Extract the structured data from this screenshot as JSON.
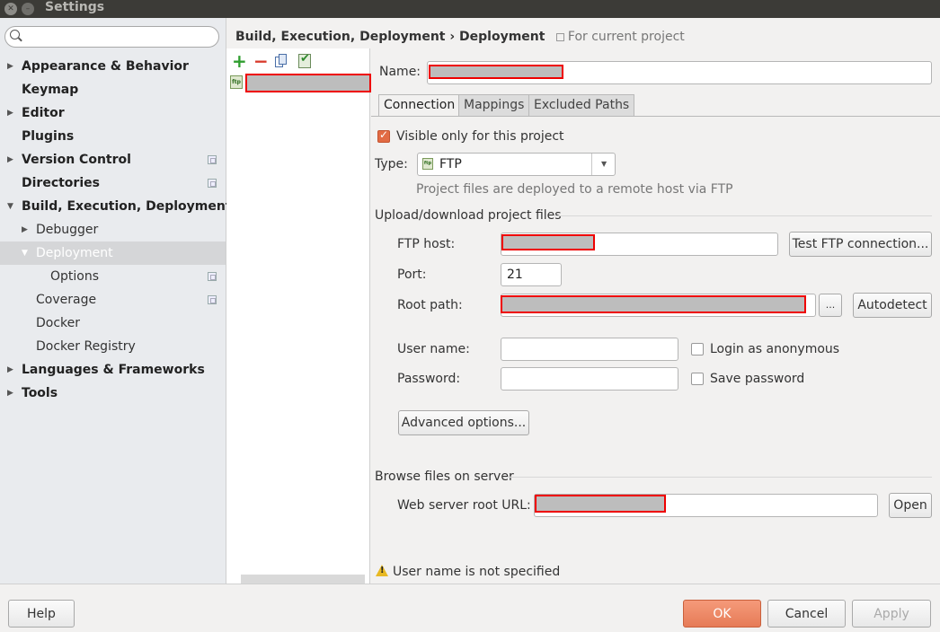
{
  "window": {
    "title": "Settings"
  },
  "search": {
    "placeholder": ""
  },
  "sidebar": {
    "items": [
      {
        "label": "Appearance & Behavior"
      },
      {
        "label": "Keymap"
      },
      {
        "label": "Editor"
      },
      {
        "label": "Plugins"
      },
      {
        "label": "Version Control"
      },
      {
        "label": "Directories"
      },
      {
        "label": "Build, Execution, Deployment"
      },
      {
        "label": "Debugger"
      },
      {
        "label": "Deployment"
      },
      {
        "label": "Options"
      },
      {
        "label": "Coverage"
      },
      {
        "label": "Docker"
      },
      {
        "label": "Docker Registry"
      },
      {
        "label": "Languages & Frameworks"
      },
      {
        "label": "Tools"
      }
    ]
  },
  "breadcrumb": {
    "path": "Build, Execution, Deployment › Deployment",
    "scope": "For current project"
  },
  "server_list": {
    "icon_label": "ftp"
  },
  "form": {
    "name_label": "Name:",
    "tabs": [
      "Connection",
      "Mappings",
      "Excluded Paths"
    ],
    "visible_only_label": "Visible only for this project",
    "visible_only_checked": true,
    "type_label": "Type:",
    "type_value": "FTP",
    "type_hint": "Project files are deployed to a remote host via FTP",
    "upload_section": "Upload/download project files",
    "ftp_host_label": "FTP host:",
    "test_connection_button": "Test FTP connection...",
    "port_label": "Port:",
    "port_value": "21",
    "root_path_label": "Root path:",
    "browse_button": "...",
    "autodetect_button": "Autodetect",
    "user_name_label": "User name:",
    "login_anonymous_label": "Login as anonymous",
    "login_anonymous_checked": false,
    "password_label": "Password:",
    "save_password_label": "Save password",
    "save_password_checked": false,
    "advanced_button": "Advanced options...",
    "browse_section": "Browse files on server",
    "web_root_label": "Web server root URL:",
    "open_button": "Open",
    "warning": "User name is not specified"
  },
  "footer": {
    "help_button": "Help",
    "ok_button": "OK",
    "cancel_button": "Cancel",
    "apply_button": "Apply"
  },
  "colors": {
    "accent": "#e67b57",
    "redaction_border": "#ee0000",
    "selection": "#d5d6d8"
  }
}
